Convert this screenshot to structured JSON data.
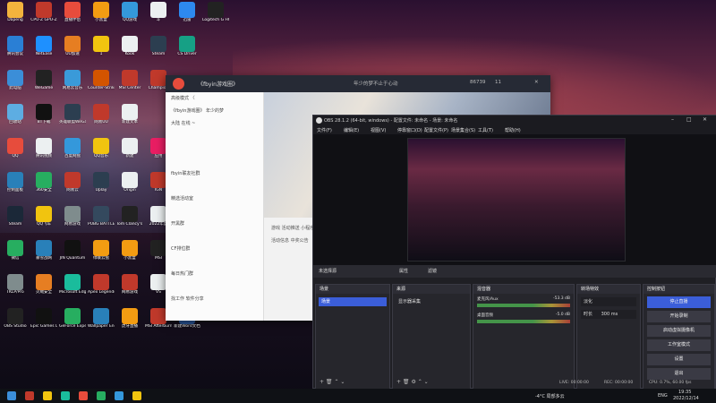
{
  "desktop": {
    "icons": [
      {
        "label": "Dapeng",
        "col": 0,
        "row": 0,
        "color": "#f2b33d"
      },
      {
        "label": "CPU-Z\nGPU-Z",
        "col": 1,
        "row": 0,
        "color": "#c0392b"
      },
      {
        "label": "直播伴侣",
        "col": 2,
        "row": 0,
        "color": "#e74c3c"
      },
      {
        "label": "小黑盒",
        "col": 3,
        "row": 0,
        "color": "#f39c12"
      },
      {
        "label": "QQ游戏",
        "col": 4,
        "row": 0,
        "color": "#3498db"
      },
      {
        "label": "斗",
        "col": 5,
        "row": 0,
        "color": "#ecf0f1"
      },
      {
        "label": "迅雷",
        "col": 6,
        "row": 0,
        "color": "#2d89ef"
      },
      {
        "label": "Logitech G HUB",
        "col": 7,
        "row": 0,
        "color": "#222"
      },
      {
        "label": "腾讯会议",
        "col": 0,
        "row": 1,
        "color": "#2a7fd5"
      },
      {
        "label": "NetEase",
        "col": 1,
        "row": 1,
        "color": "#1e90ff"
      },
      {
        "label": "UU加速",
        "col": 2,
        "row": 1,
        "color": "#e67e22"
      },
      {
        "label": "1",
        "col": 3,
        "row": 1,
        "color": "#f1c40f"
      },
      {
        "label": "Kook",
        "col": 4,
        "row": 1,
        "color": "#ecf0f1"
      },
      {
        "label": "Steam",
        "col": 5,
        "row": 1,
        "color": "#2c3e50"
      },
      {
        "label": "CS Driver",
        "col": 6,
        "row": 1,
        "color": "#16a085"
      },
      {
        "label": "此电脑",
        "col": 0,
        "row": 2,
        "color": "#3b8ed8"
      },
      {
        "label": "WeGame",
        "col": 1,
        "row": 2,
        "color": "#222"
      },
      {
        "label": "网易云音乐",
        "col": 2,
        "row": 2,
        "color": "#3a9ad9"
      },
      {
        "label": "Counter-Strike Global Off...",
        "col": 3,
        "row": 2,
        "color": "#d35400"
      },
      {
        "label": "MSI Center",
        "col": 4,
        "row": 2,
        "color": "#c0392b"
      },
      {
        "label": "Champion",
        "col": 5,
        "row": 2,
        "color": "#c0392b"
      },
      {
        "label": "回收站",
        "col": 0,
        "row": 3,
        "color": "#5dade2"
      },
      {
        "label": "BT下载",
        "col": 1,
        "row": 3,
        "color": "#111"
      },
      {
        "label": "英雄联盟WeGame版",
        "col": 2,
        "row": 3,
        "color": "#2c3e50"
      },
      {
        "label": "网易UU",
        "col": 3,
        "row": 3,
        "color": "#c0392b"
      },
      {
        "label": "新建文本",
        "col": 4,
        "row": 3,
        "color": "#ecf0f1"
      },
      {
        "label": "QQ",
        "col": 0,
        "row": 4,
        "color": "#e74c3c"
      },
      {
        "label": "腾讯视频",
        "col": 1,
        "row": 4,
        "color": "#ecf0f1"
      },
      {
        "label": "百度网盘",
        "col": 2,
        "row": 4,
        "color": "#3498db"
      },
      {
        "label": "QQ音乐",
        "col": 3,
        "row": 4,
        "color": "#f1c40f"
      },
      {
        "label": "新建",
        "col": 4,
        "row": 4,
        "color": "#ecf0f1"
      },
      {
        "label": "应用",
        "col": 5,
        "row": 4,
        "color": "#e91e63"
      },
      {
        "label": "控制面板",
        "col": 0,
        "row": 5,
        "color": "#2980b9"
      },
      {
        "label": "360安全",
        "col": 1,
        "row": 5,
        "color": "#27ae60"
      },
      {
        "label": "网易云",
        "col": 2,
        "row": 5,
        "color": "#c0392b"
      },
      {
        "label": "Uplay",
        "col": 3,
        "row": 5,
        "color": "#2c3e50"
      },
      {
        "label": "Origin",
        "col": 4,
        "row": 5,
        "color": "#ecf0f1"
      },
      {
        "label": "IGN",
        "col": 5,
        "row": 5,
        "color": "#c0392b"
      },
      {
        "label": "Steam",
        "col": 0,
        "row": 6,
        "color": "#1b2838"
      },
      {
        "label": "QQ飞车",
        "col": 1,
        "row": 6,
        "color": "#f1c40f"
      },
      {
        "label": "网易游戏",
        "col": 2,
        "row": 6,
        "color": "#7f8c8d"
      },
      {
        "label": "PUBG BATTLEGROUNDS",
        "col": 3,
        "row": 6,
        "color": "#34495e"
      },
      {
        "label": "Tom Clancy's Rainbow Six",
        "col": 4,
        "row": 6,
        "color": "#222"
      },
      {
        "label": "2022年度",
        "col": 5,
        "row": 6,
        "color": "#ecf0f1"
      },
      {
        "label": "微信",
        "col": 0,
        "row": 7,
        "color": "#27ae60"
      },
      {
        "label": "暴雪战网",
        "col": 1,
        "row": 7,
        "color": "#2980b9"
      },
      {
        "label": "JIN Quantum",
        "col": 2,
        "row": 7,
        "color": "#111"
      },
      {
        "label": "绿联云盘",
        "col": 3,
        "row": 7,
        "color": "#f39c12"
      },
      {
        "label": "小黑盒",
        "col": 4,
        "row": 7,
        "color": "#f39c12"
      },
      {
        "label": "MSI",
        "col": 5,
        "row": 7,
        "color": "#222"
      },
      {
        "label": "TKLP/Pro",
        "col": 0,
        "row": 8,
        "color": "#7f8c8d"
      },
      {
        "label": "火绒安全",
        "col": 1,
        "row": 8,
        "color": "#e67e22"
      },
      {
        "label": "Microsoft Edge",
        "col": 2,
        "row": 8,
        "color": "#1abc9c"
      },
      {
        "label": "Apex Legends",
        "col": 3,
        "row": 8,
        "color": "#c0392b"
      },
      {
        "label": "网易游戏",
        "col": 4,
        "row": 8,
        "color": "#c0392b"
      },
      {
        "label": "VS",
        "col": 5,
        "row": 8,
        "color": "#ecf0f1"
      },
      {
        "label": "OBS Studio",
        "col": 0,
        "row": 9,
        "color": "#222"
      },
      {
        "label": "Epic Games Launcher",
        "col": 1,
        "row": 9,
        "color": "#111"
      },
      {
        "label": "GeForce Experience",
        "col": 2,
        "row": 9,
        "color": "#27ae60"
      },
      {
        "label": "Wallpaper Engine",
        "col": 3,
        "row": 9,
        "color": "#2980b9"
      },
      {
        "label": "虎牙直播",
        "col": 4,
        "row": 9,
        "color": "#f39c12"
      },
      {
        "label": "MSI Afterburner",
        "col": 5,
        "row": 9,
        "color": "#c0392b"
      },
      {
        "label": "新建Word文档",
        "col": 6,
        "row": 9,
        "color": "#2b579a"
      }
    ]
  },
  "chat_window": {
    "title": "《fbyin游戏圈》",
    "subtitle": "年少的梦不止于心动",
    "views": "86739",
    "likes": "11",
    "sidebar": [
      "高级模式 〈",
      "《fbyin游戏圈》 年少的梦",
      "大陆 在线 ~",
      "",
      "",
      "",
      "fbyin联友社群",
      "",
      "精选活动室",
      "",
      "开黑群",
      "",
      "CF排位群",
      "",
      "每日热门群",
      "",
      "找工作 软件分享"
    ],
    "footer_left": "浏览 ",
    "footer_text1": "游戏 活动推送 小程序",
    "footer_text2": "活动信息 中奖公告"
  },
  "obs": {
    "title": "OBS 28.1.2 (64-bit, windows) - 配置文件: 未命名 - 场景: 未命名",
    "menu": [
      "文件(F)",
      "编辑(E)",
      "视图(V)",
      "停靠窗口(D)",
      "配置文件(P)",
      "场景集合(S)",
      "工具(T)",
      "帮助(H)"
    ],
    "scene_bar": {
      "label": "未选择源",
      "props": "属性",
      "filters": "滤镜"
    },
    "docks": {
      "scenes": {
        "title": "场景",
        "item": "场景"
      },
      "sources": {
        "title": "来源",
        "item": "显示器采集"
      },
      "mixer": {
        "title": "混音器",
        "rows": [
          {
            "name": "麦克风/Aux",
            "db": "-53.3 dB"
          },
          {
            "name": "桌面音频",
            "db": "-5.0 dB"
          }
        ]
      },
      "transitions": {
        "title": "转场特效",
        "type": "淡化",
        "duration_label": "时长",
        "duration": "300 ms"
      },
      "controls": {
        "title": "控制按钮",
        "buttons": [
          "停止直播",
          "开始录制",
          "启动虚拟摄像机",
          "工作室模式",
          "设置",
          "退出"
        ]
      }
    },
    "status": {
      "live": "LIVE: 00:00:00",
      "rec": "REC: 00:00:00",
      "cpu": "CPU: 0.7%, 60.00 fps"
    }
  },
  "taskbar": {
    "weather": "-4°C 局部多云",
    "lang": "ENG",
    "time": "19:35",
    "date": "2022/12/14"
  }
}
